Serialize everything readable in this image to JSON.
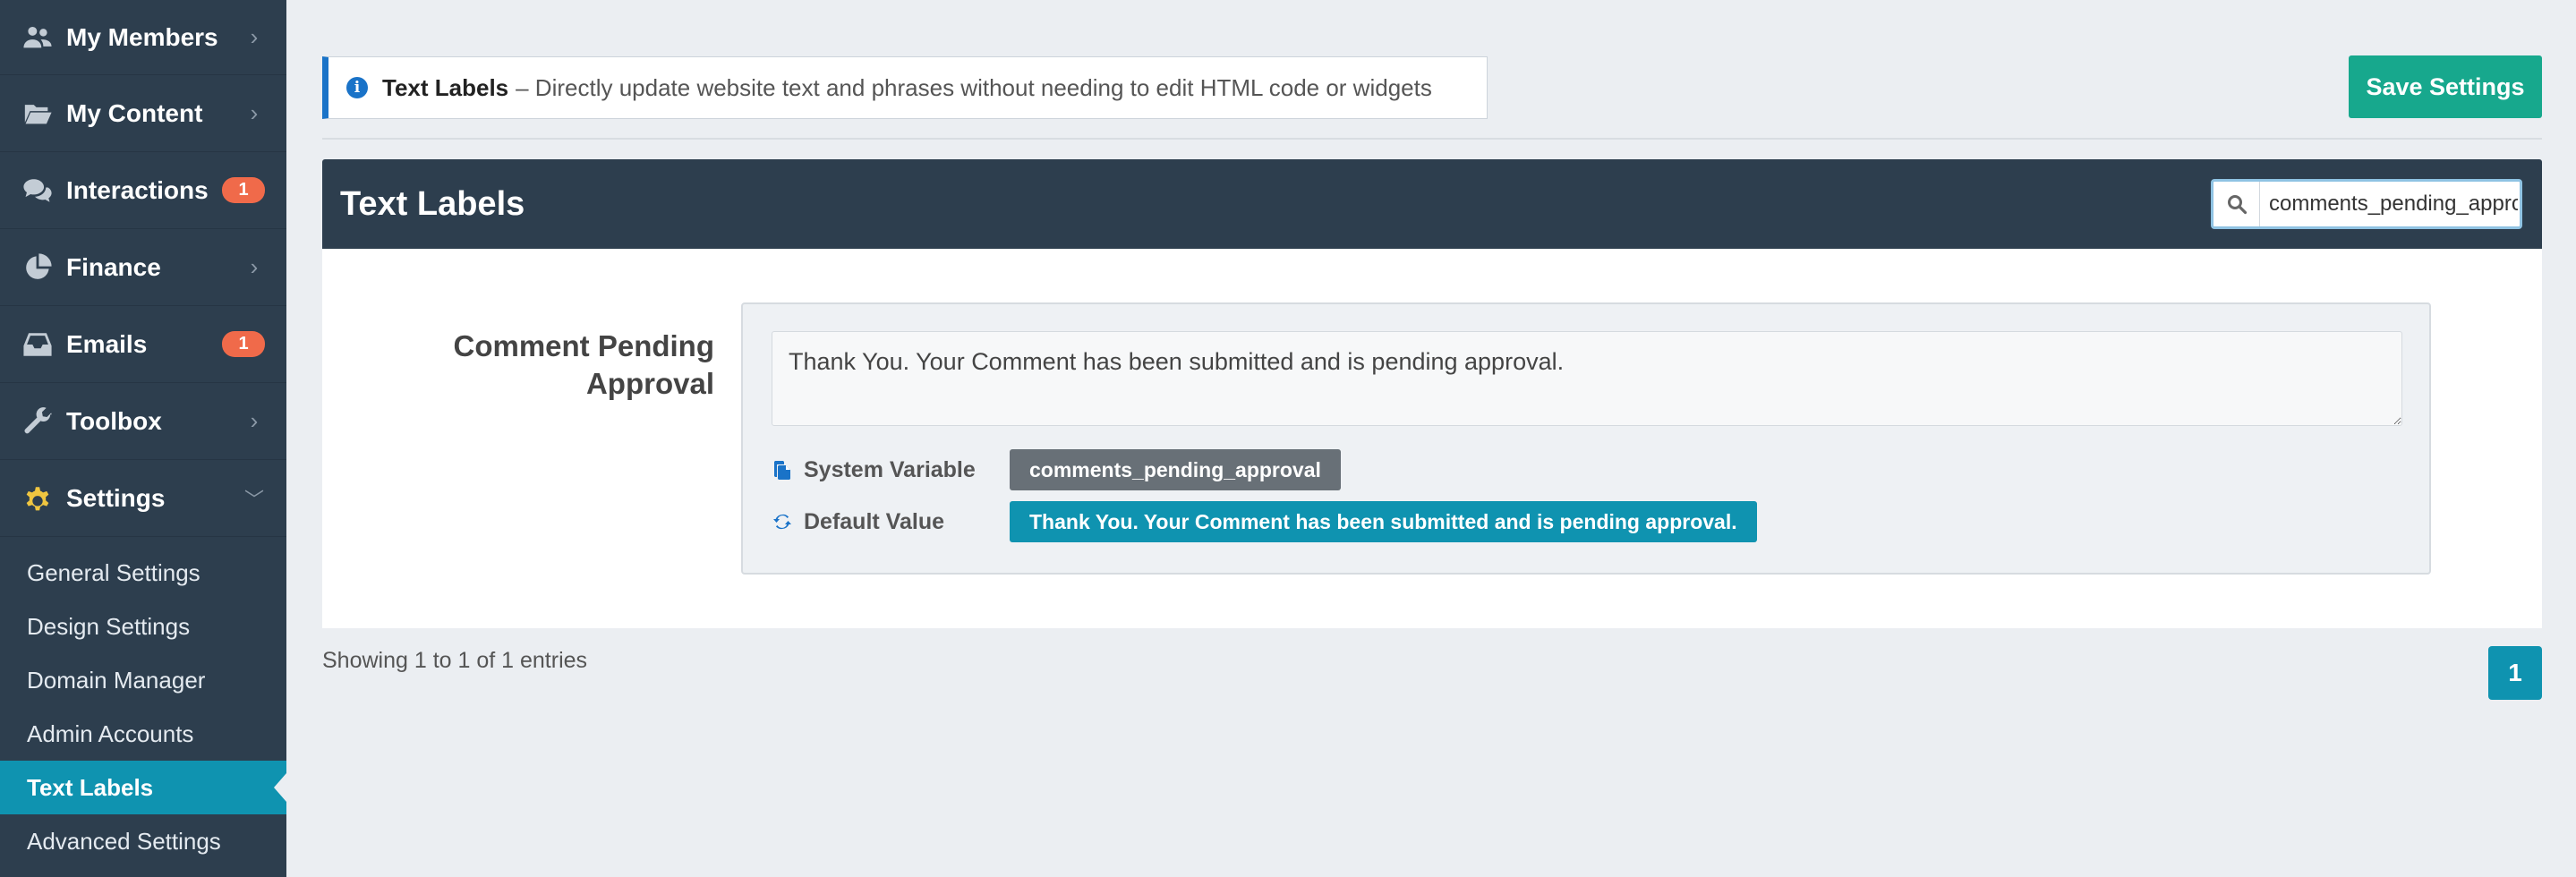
{
  "sidebar": {
    "items": [
      {
        "label": "My Members",
        "icon": "users-icon",
        "badge": ""
      },
      {
        "label": "My Content",
        "icon": "folder-open-icon",
        "badge": ""
      },
      {
        "label": "Interactions",
        "icon": "comments-icon",
        "badge": "1"
      },
      {
        "label": "Finance",
        "icon": "pie-chart-icon",
        "badge": ""
      },
      {
        "label": "Emails",
        "icon": "inbox-icon",
        "badge": "1"
      },
      {
        "label": "Toolbox",
        "icon": "wrench-icon",
        "badge": ""
      },
      {
        "label": "Settings",
        "icon": "gear-icon",
        "badge": ""
      }
    ],
    "submenu": [
      {
        "label": "General Settings"
      },
      {
        "label": "Design Settings"
      },
      {
        "label": "Domain Manager"
      },
      {
        "label": "Admin Accounts"
      },
      {
        "label": "Text Labels"
      },
      {
        "label": "Advanced Settings"
      }
    ]
  },
  "banner": {
    "title": "Text Labels",
    "description": "– Directly update website text and phrases without needing to edit HTML code or widgets"
  },
  "toolbar": {
    "save_label": "Save Settings"
  },
  "panel": {
    "title": "Text Labels",
    "search_value": "comments_pending_approval"
  },
  "field": {
    "label": "Comment Pending Approval",
    "value": "Thank You. Your Comment has been submitted and is pending approval.",
    "system_variable_label": "System Variable",
    "system_variable": "comments_pending_approval",
    "default_value_label": "Default Value",
    "default_value": "Thank You. Your Comment has been submitted and is pending approval."
  },
  "footer": {
    "entries": "Showing 1 to 1 of 1 entries",
    "page": "1"
  },
  "colors": {
    "sidebar_bg": "#2d3e4e",
    "accent_teal": "#0f93b0",
    "save_green": "#17a88d",
    "badge_orange": "#f06a4a",
    "info_blue": "#1a73c8"
  }
}
